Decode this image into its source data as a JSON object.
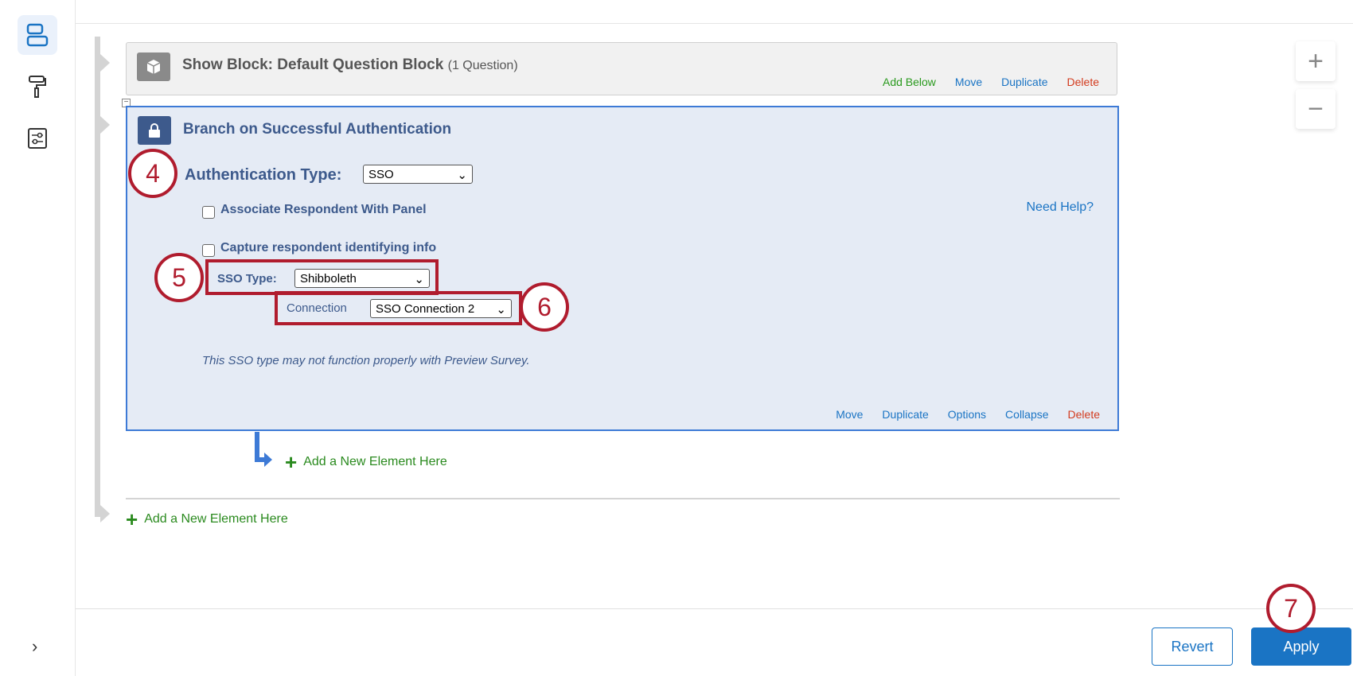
{
  "sidebar": {
    "items": [
      {
        "icon": "survey-flow-icon",
        "active": true
      },
      {
        "icon": "paint-roller-icon"
      },
      {
        "icon": "settings-sliders-icon"
      }
    ],
    "expand_icon": "chevron-right-icon"
  },
  "show_block": {
    "title": "Show Block: Default Question Block",
    "count": "(1 Question)",
    "links": {
      "add_below": "Add Below",
      "move": "Move",
      "duplicate": "Duplicate",
      "delete": "Delete"
    }
  },
  "branch": {
    "title": "Branch on Successful Authentication",
    "auth_label": "Authentication Type:",
    "auth_value": "SSO",
    "associate_label": "Associate Respondent With Panel",
    "capture_label": "Capture respondent identifying info",
    "need_help": "Need Help?",
    "sso_type_label": "SSO Type:",
    "sso_type_value": "Shibboleth",
    "connection_label": "Connection",
    "connection_value": "SSO Connection 2",
    "warning": "This SSO type may not function properly with Preview Survey.",
    "links": {
      "move": "Move",
      "duplicate": "Duplicate",
      "options": "Options",
      "collapse": "Collapse",
      "delete": "Delete"
    }
  },
  "add_new_inner": "Add a New Element Here",
  "add_new_outer": "Add a New Element Here",
  "zoom": {
    "in": "+",
    "out": "−"
  },
  "footer": {
    "revert": "Revert",
    "apply": "Apply"
  },
  "callouts": [
    "4",
    "5",
    "6",
    "7"
  ],
  "colors": {
    "accent": "#1a74c4",
    "callout": "#b01c2e",
    "add": "#2a9a1e",
    "delete": "#d33b1e"
  }
}
